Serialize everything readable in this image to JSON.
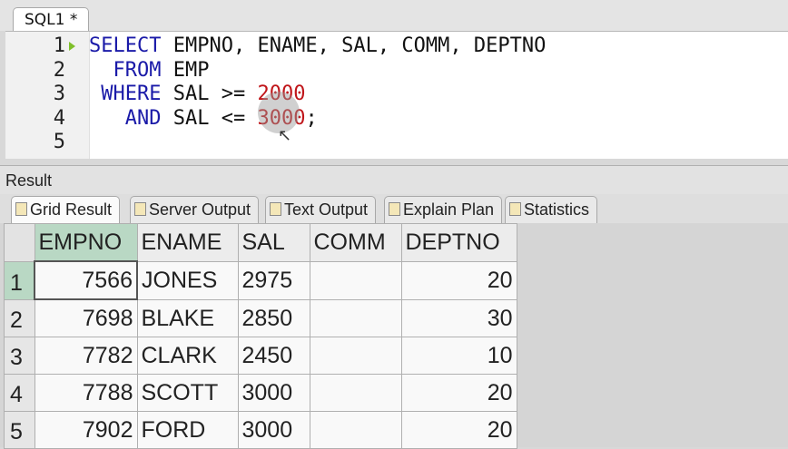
{
  "editor_tab": {
    "label": "SQL1 *"
  },
  "editor": {
    "line_numbers": [
      "1",
      "2",
      "3",
      "4",
      "5"
    ],
    "lines": [
      [
        {
          "t": "SELECT",
          "k": "kw"
        },
        {
          "t": " EMPNO, ENAME, SAL, COMM, DEPTNO",
          "k": ""
        }
      ],
      [
        {
          "t": "  FROM",
          "k": "kw"
        },
        {
          "t": " EMP",
          "k": ""
        }
      ],
      [
        {
          "t": " WHERE",
          "k": "kw"
        },
        {
          "t": " SAL >= ",
          "k": ""
        },
        {
          "t": "2000",
          "k": "num"
        }
      ],
      [
        {
          "t": "   AND",
          "k": "kw"
        },
        {
          "t": " SAL <= ",
          "k": ""
        },
        {
          "t": "3000",
          "k": "num"
        },
        {
          "t": ";",
          "k": ""
        }
      ],
      []
    ]
  },
  "result_panel": {
    "title": "Result",
    "tabs": [
      {
        "label": "Grid Result",
        "icon": "grid-icon",
        "active": true
      },
      {
        "label": "Server Output",
        "icon": "server-output-icon",
        "active": false
      },
      {
        "label": "Text Output",
        "icon": "text-output-icon",
        "active": false
      },
      {
        "label": "Explain Plan",
        "icon": "explain-plan-icon",
        "active": false
      },
      {
        "label": "Statistics",
        "icon": "statistics-icon",
        "active": false
      }
    ]
  },
  "grid": {
    "columns": [
      "EMPNO",
      "ENAME",
      "SAL",
      "COMM",
      "DEPTNO"
    ],
    "rows": [
      {
        "n": "1",
        "cells": [
          "7566",
          "JONES",
          "2975",
          "",
          "20"
        ]
      },
      {
        "n": "2",
        "cells": [
          "7698",
          "BLAKE",
          "2850",
          "",
          "30"
        ]
      },
      {
        "n": "3",
        "cells": [
          "7782",
          "CLARK",
          "2450",
          "",
          "10"
        ]
      },
      {
        "n": "4",
        "cells": [
          "7788",
          "SCOTT",
          "3000",
          "",
          "20"
        ]
      },
      {
        "n": "5",
        "cells": [
          "7902",
          "FORD",
          "3000",
          "",
          "20"
        ]
      }
    ]
  },
  "colors": {
    "keyword": "#1a1aa8",
    "number_literal": "#c0161a",
    "selection": "#b9d8c4",
    "run_marker": "#7fbf2a"
  }
}
